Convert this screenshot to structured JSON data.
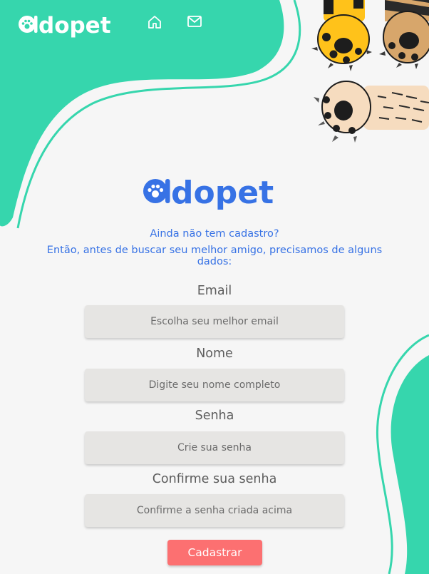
{
  "header": {
    "logo_text": "adopet",
    "nav": [
      {
        "icon": "home-icon"
      },
      {
        "icon": "mail-icon"
      }
    ]
  },
  "main": {
    "logo_text": "adopet",
    "intro_line1": "Ainda não tem cadastro?",
    "intro_line2": "Então, antes de buscar seu melhor amigo, precisamos de alguns dados:",
    "form": {
      "email_label": "Email",
      "email_placeholder": "Escolha seu melhor email",
      "nome_label": "Nome",
      "nome_placeholder": "Digite seu nome completo",
      "senha_label": "Senha",
      "senha_placeholder": "Crie sua senha",
      "confirma_label": "Confirme sua senha",
      "confirma_placeholder": "Confirme a senha criada acima",
      "submit_label": "Cadastrar"
    }
  },
  "colors": {
    "accent_green": "#36d6ad",
    "brand_blue": "#3772e5",
    "button_red": "#fc7071",
    "background": "#f6f6f6",
    "input_bg": "#e6e5e3"
  }
}
